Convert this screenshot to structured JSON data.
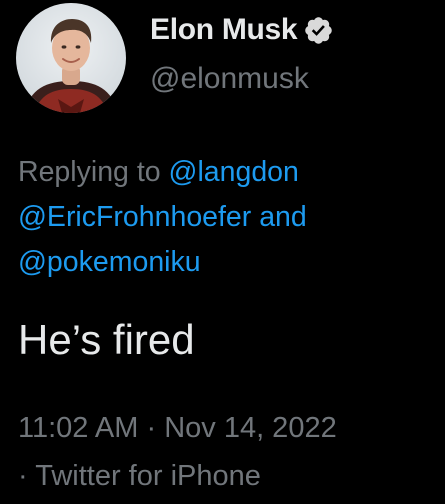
{
  "author": {
    "display_name": "Elon Musk",
    "handle": "@elonmusk",
    "verified": true,
    "avatar_icon": "profile-photo"
  },
  "reply_context": {
    "prefix": "Replying to",
    "mentions": [
      "@langdon",
      "@EricFrohnhoefer",
      "@pokemoniku"
    ],
    "conjunction": "and"
  },
  "tweet": {
    "text": "He’s fired"
  },
  "meta": {
    "time": "11:02 AM",
    "separator": "·",
    "date": "Nov 14, 2022",
    "source": "Twitter for iPhone"
  },
  "colors": {
    "background": "#000000",
    "text": "#e7e9ea",
    "secondary": "#71767b",
    "link": "#1d9bf0",
    "verified_badge": "#d9d9d9"
  }
}
